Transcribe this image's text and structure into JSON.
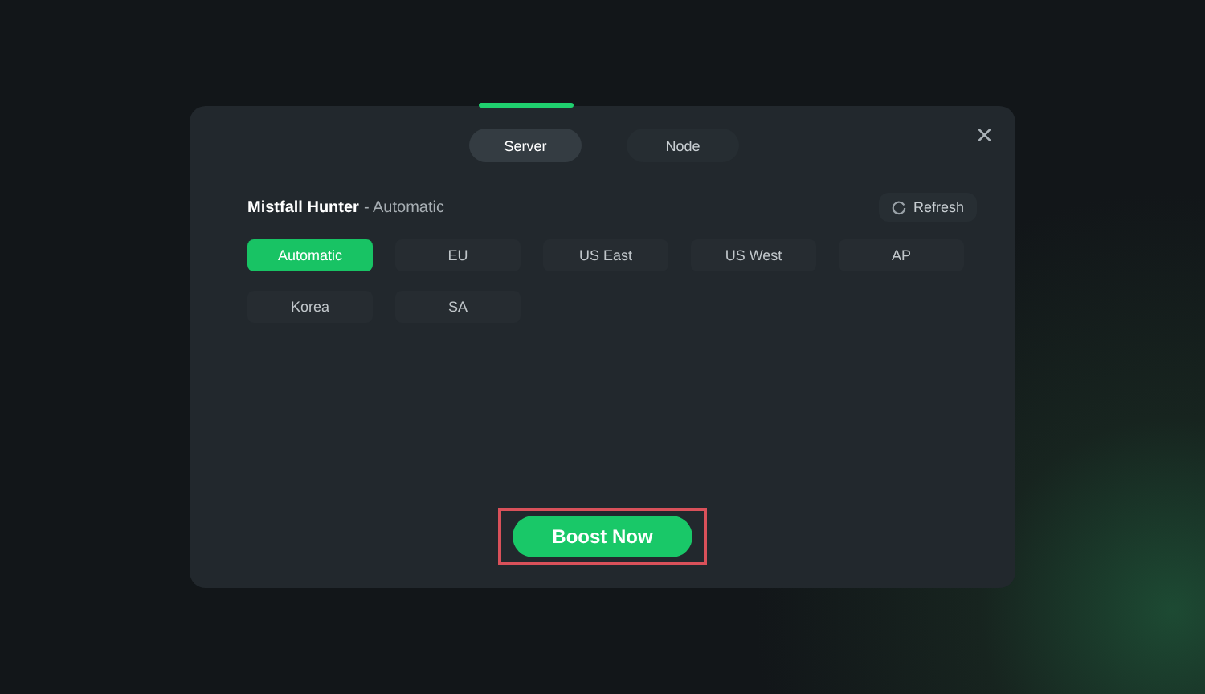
{
  "tabs": [
    {
      "label": "Server",
      "selected": true
    },
    {
      "label": "Node",
      "selected": false
    }
  ],
  "close": {
    "label": "×"
  },
  "header": {
    "game": "Mistfall Hunter",
    "mode": "- Automatic",
    "refresh": "Refresh"
  },
  "regions": [
    {
      "label": "Automatic",
      "selected": true
    },
    {
      "label": "EU",
      "selected": false
    },
    {
      "label": "US East",
      "selected": false
    },
    {
      "label": "US West",
      "selected": false
    },
    {
      "label": "AP",
      "selected": false
    },
    {
      "label": "Korea",
      "selected": false
    },
    {
      "label": "SA",
      "selected": false
    }
  ],
  "action": {
    "label": "Boost Now",
    "highlighted": true
  }
}
